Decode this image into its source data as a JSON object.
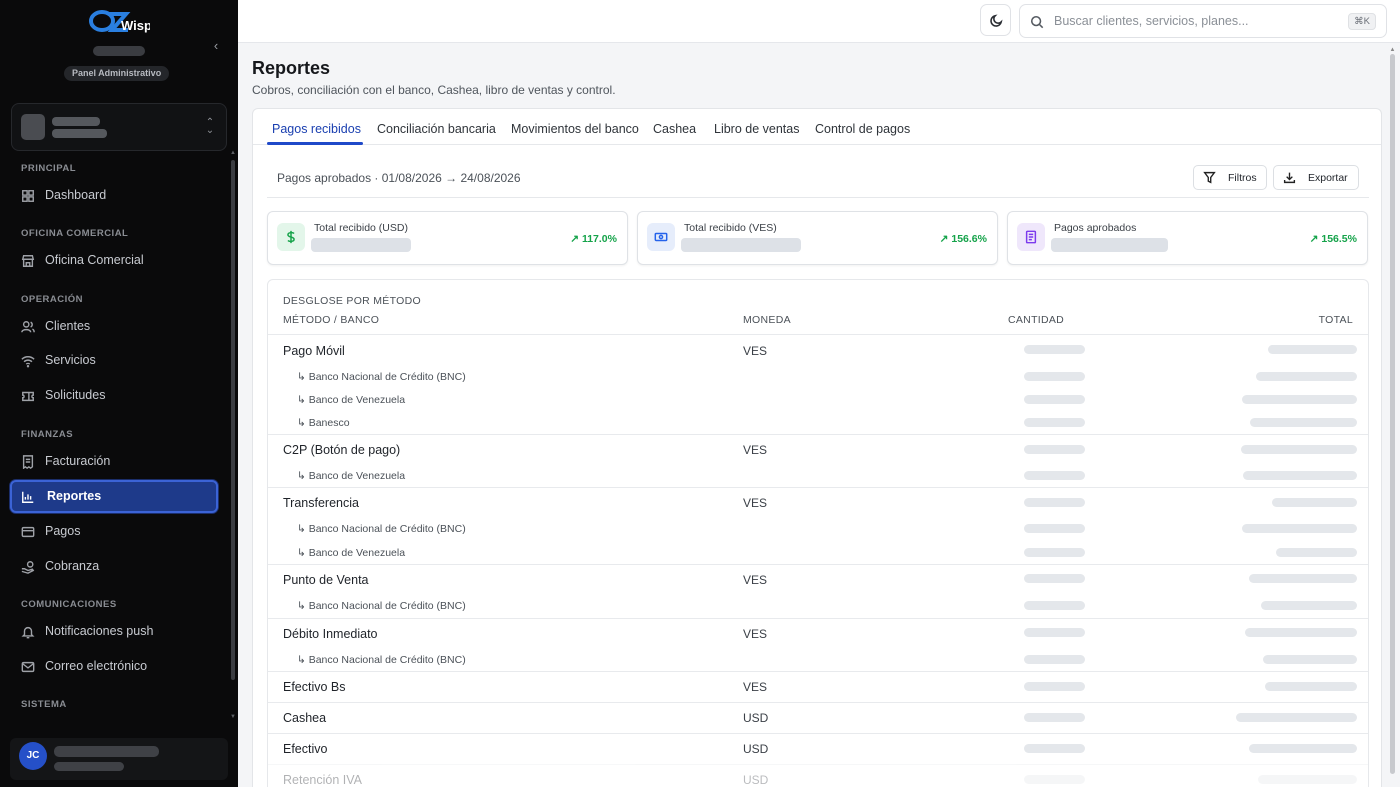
{
  "brand": {
    "logo_text": "OZWisp",
    "panel_badge": "Panel Administrativo"
  },
  "sidebar": {
    "sections": [
      {
        "title": "PRINCIPAL",
        "items": [
          {
            "label": "Dashboard",
            "icon": "grid-icon"
          }
        ]
      },
      {
        "title": "OFICINA COMERCIAL",
        "items": [
          {
            "label": "Oficina Comercial",
            "icon": "store-icon"
          }
        ]
      },
      {
        "title": "OPERACIÓN",
        "items": [
          {
            "label": "Clientes",
            "icon": "users-icon"
          },
          {
            "label": "Servicios",
            "icon": "wifi-icon"
          },
          {
            "label": "Solicitudes",
            "icon": "ticket-icon"
          }
        ]
      },
      {
        "title": "FINANZAS",
        "items": [
          {
            "label": "Facturación",
            "icon": "receipt-icon"
          },
          {
            "label": "Reportes",
            "icon": "bar-chart-icon",
            "active": true
          },
          {
            "label": "Pagos",
            "icon": "credit-card-icon"
          },
          {
            "label": "Cobranza",
            "icon": "hand-coins-icon"
          }
        ]
      },
      {
        "title": "COMUNICACIONES",
        "items": [
          {
            "label": "Notificaciones push",
            "icon": "bell-icon"
          },
          {
            "label": "Correo electrónico",
            "icon": "mail-icon"
          }
        ]
      },
      {
        "title": "SISTEMA",
        "items": []
      }
    ],
    "user_initials": "JC"
  },
  "topbar": {
    "search_placeholder": "Buscar clientes, servicios, planes...",
    "shortcut": "⌘K"
  },
  "page": {
    "title": "Reportes",
    "subtitle": "Cobros, conciliación con el banco, Cashea, libro de ventas y control."
  },
  "tabs": [
    "Pagos recibidos",
    "Conciliación bancaria",
    "Movimientos del banco",
    "Cashea",
    "Libro de ventas",
    "Control de pagos"
  ],
  "active_tab": "Pagos recibidos",
  "filters": {
    "summary": "Pagos aprobados · 01/08/2026 → 24/08/2026",
    "filter_button": "Filtros",
    "export_button": "Exportar"
  },
  "stats": [
    {
      "label": "Total recibido (USD)",
      "trend": "117.0%",
      "icon": "dollar-icon",
      "color": "#16a34a"
    },
    {
      "label": "Total recibido (VES)",
      "trend": "156.6%",
      "icon": "banknote-icon",
      "color": "#2563eb"
    },
    {
      "label": "Pagos aprobados",
      "trend": "156.5%",
      "icon": "document-icon",
      "color": "#7c3aed"
    }
  ],
  "breakdown": {
    "caption": "DESGLOSE POR MÉTODO",
    "headers": {
      "method": "MÉTODO / BANCO",
      "currency": "MONEDA",
      "quantity": "CANTIDAD",
      "total": "TOTAL"
    },
    "rows": [
      {
        "method": "Pago Móvil",
        "currency": "VES",
        "banks": [
          "↳ Banco Nacional de Crédito (BNC)",
          "↳ Banco de Venezuela",
          "↳ Banesco"
        ]
      },
      {
        "method": "C2P (Botón de pago)",
        "currency": "VES",
        "banks": [
          "↳ Banco de Venezuela"
        ]
      },
      {
        "method": "Transferencia",
        "currency": "VES",
        "banks": [
          "↳ Banco Nacional de Crédito (BNC)",
          "↳ Banco de Venezuela"
        ]
      },
      {
        "method": "Punto de Venta",
        "currency": "VES",
        "banks": [
          "↳ Banco Nacional de Crédito (BNC)"
        ]
      },
      {
        "method": "Débito Inmediato",
        "currency": "VES",
        "banks": [
          "↳ Banco Nacional de Crédito (BNC)"
        ]
      },
      {
        "method": "Efectivo Bs",
        "currency": "VES",
        "banks": []
      },
      {
        "method": "Cashea",
        "currency": "USD",
        "banks": []
      },
      {
        "method": "Efectivo",
        "currency": "USD",
        "banks": []
      },
      {
        "method": "Retención IVA",
        "currency": "USD",
        "banks": []
      }
    ]
  },
  "colors": {
    "sidebar_bg": "#0a0a0b",
    "accent": "#1e3a8a",
    "positive": "#16a34a"
  }
}
